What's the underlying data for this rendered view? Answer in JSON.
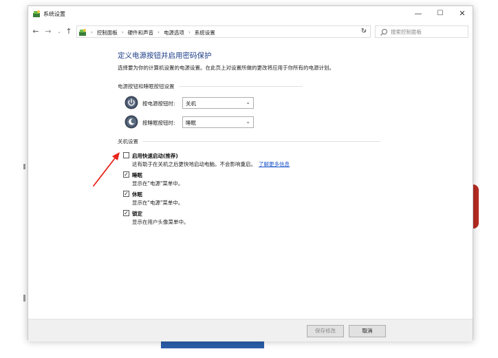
{
  "window": {
    "title": "系统设置",
    "controls": {
      "minimize": "—",
      "maximize": "☐",
      "close": "✕"
    }
  },
  "nav": {
    "back": "←",
    "forward": "→",
    "recent": "⌄",
    "up": "↑",
    "breadcrumbs": [
      "控制面板",
      "硬件和声音",
      "电源选项",
      "系统设置"
    ],
    "crumb_separator": "›",
    "dropdown": "⌄",
    "refresh": "↻",
    "search_placeholder": "搜索控制面板"
  },
  "page": {
    "title": "定义电源按钮并启用密码保护",
    "description": "选择要为你的计算机设置的电源设置。在此页上对设置所做的更改将应用于你所有的电源计划。"
  },
  "power_buttons": {
    "section_title": "电源按钮和睡眠按钮设置",
    "rows": [
      {
        "label": "按电源按钮时:",
        "value": "关机",
        "icon": "power-button-icon"
      },
      {
        "label": "按睡眠按钮时:",
        "value": "睡眠",
        "icon": "sleep-button-icon"
      }
    ]
  },
  "shutdown": {
    "section_title": "关机设置",
    "options": [
      {
        "label": "启用快速启动(推荐)",
        "checked": false,
        "description": "这有助于在关机之后更快地启动电脑。不会影响重启。",
        "link": "了解更多信息"
      },
      {
        "label": "睡眠",
        "checked": true,
        "description": "显示在\"电源\"菜单中。"
      },
      {
        "label": "休眠",
        "checked": true,
        "description": "显示在\"电源\"菜单中。"
      },
      {
        "label": "锁定",
        "checked": true,
        "description": "显示在用户头像菜单中。"
      }
    ]
  },
  "footer": {
    "save": "保存修改",
    "cancel": "取消"
  },
  "checkmark": "✓",
  "colors": {
    "title": "#1e3f8a",
    "link": "#1a55c8",
    "annotation_arrow": "#e8231b"
  }
}
